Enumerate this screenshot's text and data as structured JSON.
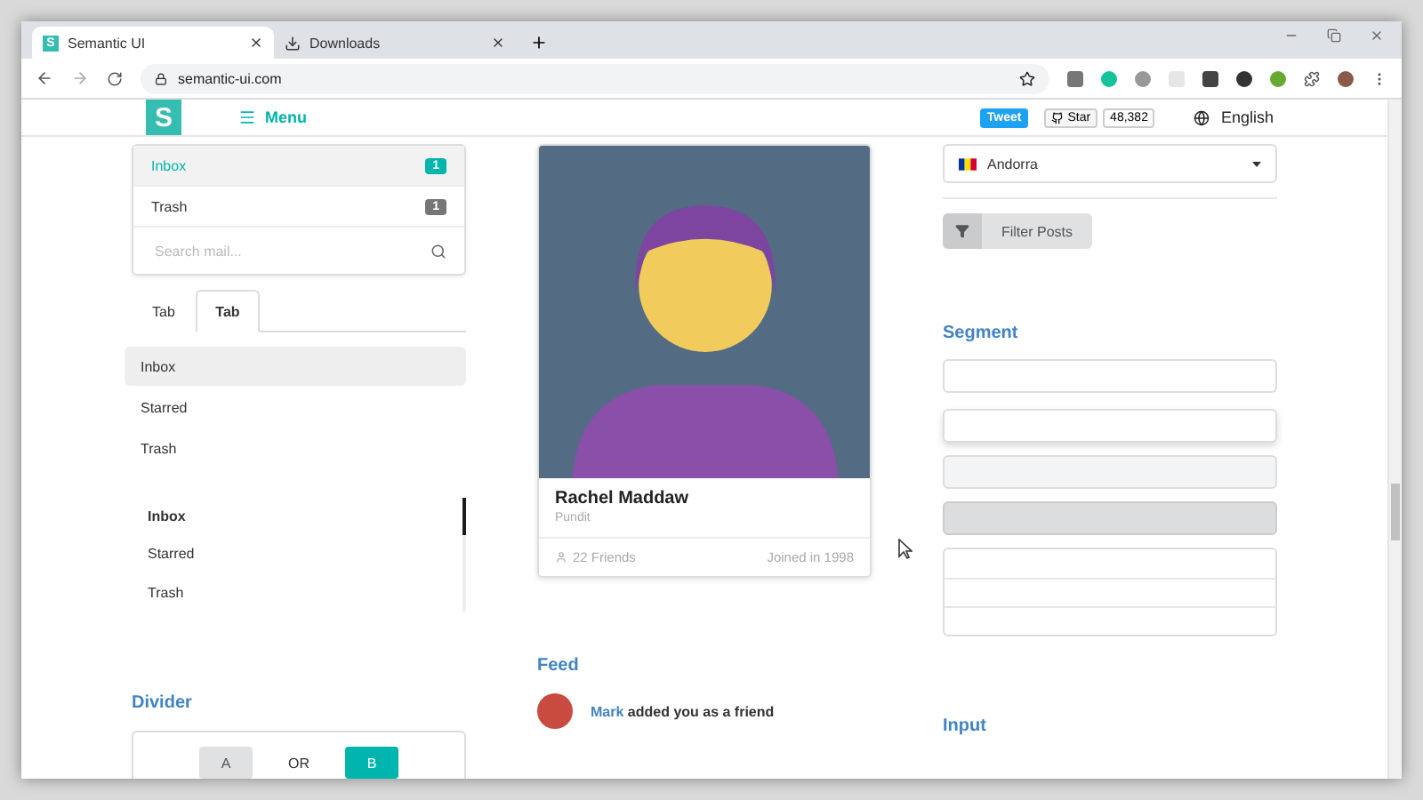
{
  "browser": {
    "tabs": [
      {
        "title": "Semantic UI",
        "selected": true,
        "favicon": "S"
      },
      {
        "title": "Downloads",
        "selected": false
      }
    ],
    "address": "semantic-ui.com"
  },
  "header": {
    "logo": "S",
    "menu": "Menu",
    "tweet": "Tweet",
    "star": "Star",
    "star_count": "48,382",
    "language": "English"
  },
  "mail_menu": {
    "items": [
      {
        "label": "Inbox",
        "count": "1",
        "selected": true,
        "color": "#00b5ad"
      },
      {
        "label": "Trash",
        "count": "1",
        "selected": false,
        "color": "#767676"
      }
    ],
    "search": {
      "placeholder": "Search mail..."
    }
  },
  "tabs": [
    {
      "label": "Tab",
      "selected": false
    },
    {
      "label": "Tab",
      "selected": true
    }
  ],
  "menu": [
    {
      "label": "Inbox",
      "selected": true
    },
    {
      "label": "Starred",
      "selected": false
    },
    {
      "label": "Trash",
      "selected": false
    }
  ],
  "vertical_menu": [
    {
      "label": "Inbox",
      "selected": true
    },
    {
      "label": "Starred",
      "selected": false
    },
    {
      "label": "Trash",
      "selected": false
    }
  ],
  "divider": {
    "heading": "Divider",
    "left": "A",
    "middle": "OR",
    "right": "B"
  },
  "card": {
    "name": "Rachel Maddaw",
    "meta": "Pundit",
    "friends": "22 Friends",
    "joined": "Joined in 1998"
  },
  "feed": {
    "heading": "Feed",
    "user": "Mark",
    "text": " added you as a friend"
  },
  "dropdown": {
    "value": "Andorra"
  },
  "filter_button": "Filter Posts",
  "segment": {
    "heading": "Segment",
    "segments": [
      {
        "kind": "plain"
      },
      {
        "kind": "raised"
      },
      {
        "kind": "secondary"
      },
      {
        "kind": "tertiary"
      },
      {
        "kind": "group"
      }
    ]
  },
  "input": {
    "heading": "Input"
  }
}
